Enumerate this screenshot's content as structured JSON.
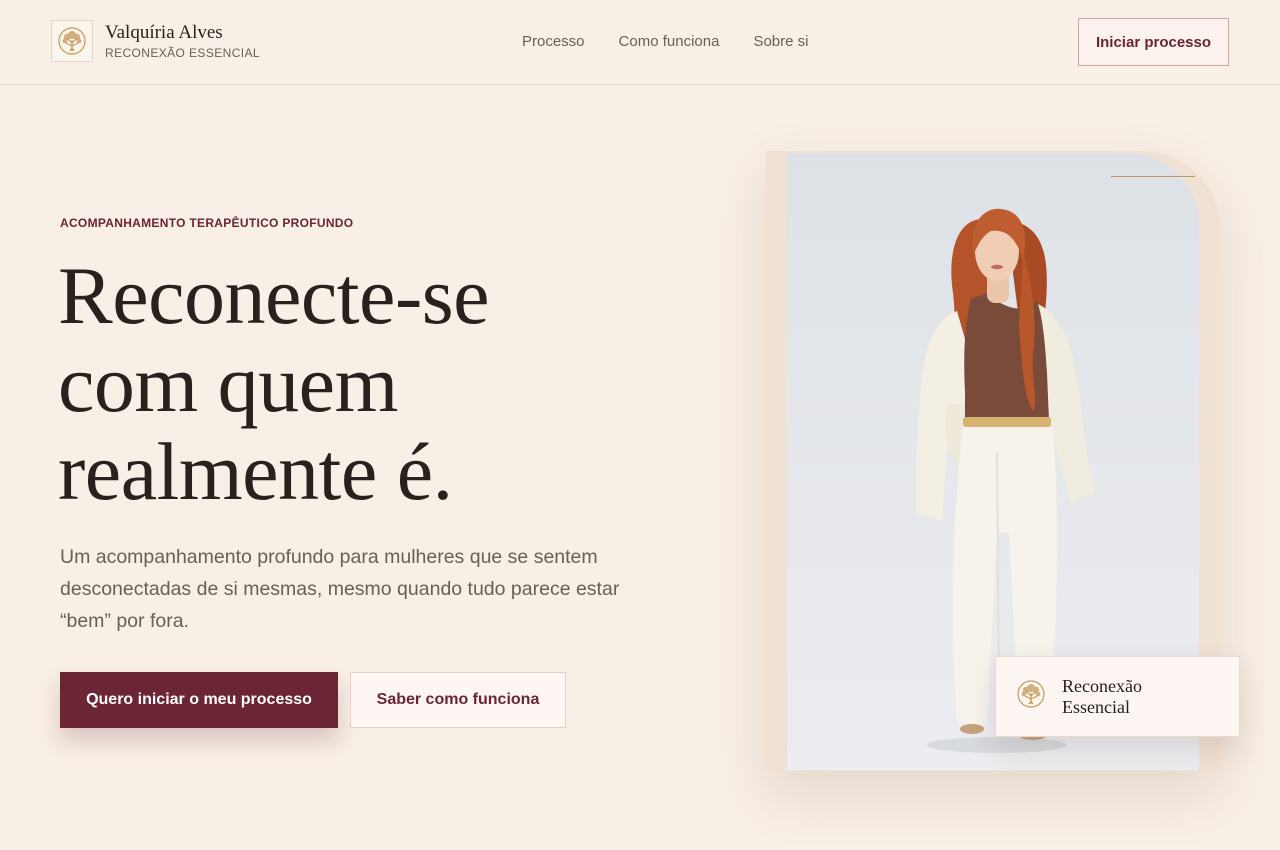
{
  "brand": {
    "name": "Valquíria Alves",
    "subtitle": "RECONEXÃO ESSENCIAL",
    "logo_icon": "tree-of-life-icon"
  },
  "nav": {
    "items": [
      "Processo",
      "Como funciona",
      "Sobre si"
    ]
  },
  "header": {
    "cta_label": "Iniciar processo"
  },
  "hero": {
    "eyebrow": "ACOMPANHAMENTO TERAPÊUTICO PROFUNDO",
    "headline_lines": [
      "Reconecte-se",
      "com quem",
      "realmente é."
    ],
    "lead": "Um acompanhamento profundo para mulheres que se sentem desconectadas de si mesmas, mesmo quando tudo parece estar “bem” por fora.",
    "primary_cta": "Quero iniciar o meu processo",
    "secondary_cta": "Saber como funciona"
  },
  "badge": {
    "lines": [
      "Reconexão",
      "Essencial"
    ],
    "icon": "tree-of-life-icon"
  },
  "colors": {
    "background": "#f8efe6",
    "accent": "#6b2535",
    "text": "#2a211e",
    "muted": "#6b5d57",
    "gold": "#c49a5a"
  }
}
